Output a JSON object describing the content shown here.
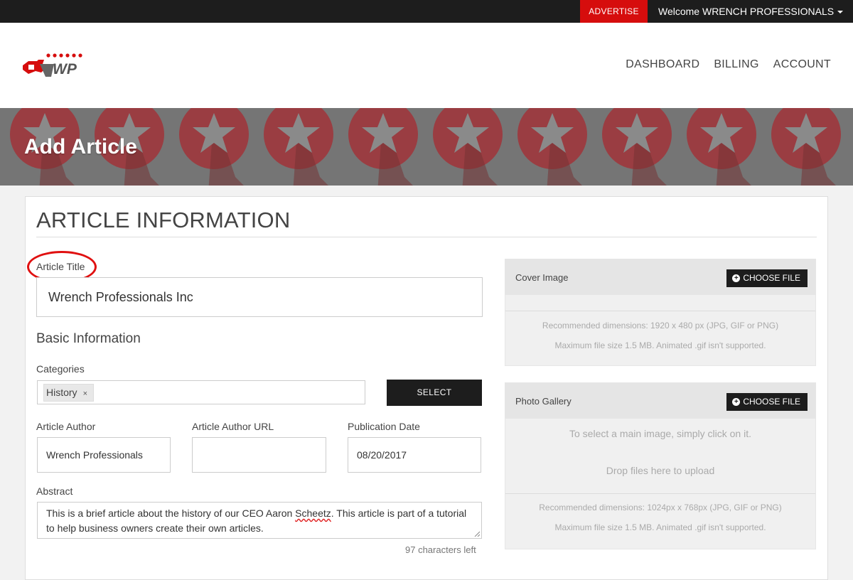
{
  "topbar": {
    "advertise_label": "ADVERTISE",
    "welcome_label": "Welcome WRENCH PROFESSIONALS"
  },
  "header": {
    "logo_text": "WP",
    "nav": [
      "DASHBOARD",
      "BILLING",
      "ACCOUNT"
    ]
  },
  "banner": {
    "title": "Add Article"
  },
  "form": {
    "section_title": "ARTICLE INFORMATION",
    "article_title_label": "Article Title",
    "article_title_value": "Wrench Professionals Inc",
    "basic_info_heading": "Basic Information",
    "categories_label": "Categories",
    "category_chip": "History",
    "chip_remove": "×",
    "select_button": "SELECT",
    "author_label": "Article Author",
    "author_value": "Wrench Professionals",
    "author_url_label": "Article Author URL",
    "author_url_value": "",
    "pub_date_label": "Publication Date",
    "pub_date_value": "08/20/2017",
    "abstract_label": "Abstract",
    "abstract_value_part1": "This is a brief article about the history of our CEO Aaron ",
    "abstract_value_misspelled": "Scheetz",
    "abstract_value_part2": ". This article is part of a tutorial to help business owners create their own articles.",
    "chars_left": "97 characters left"
  },
  "cover_image": {
    "label": "Cover Image",
    "button": "CHOOSE FILE",
    "note1": "Recommended dimensions: 1920 x 480 px (JPG, GIF or PNG)",
    "note2": "Maximum file size 1.5 MB. Animated .gif isn't supported."
  },
  "photo_gallery": {
    "label": "Photo Gallery",
    "button": "CHOOSE FILE",
    "hint": "To select a main image, simply click on it.",
    "drop": "Drop files here to upload",
    "note1": "Recommended dimensions: 1024px x 768px (JPG, GIF or PNG)",
    "note2": "Maximum file size 1.5 MB. Animated .gif isn't supported."
  },
  "colors": {
    "accent_red": "#d60d0d",
    "dark": "#1d1d1d",
    "star_badge": "#b3242b"
  }
}
